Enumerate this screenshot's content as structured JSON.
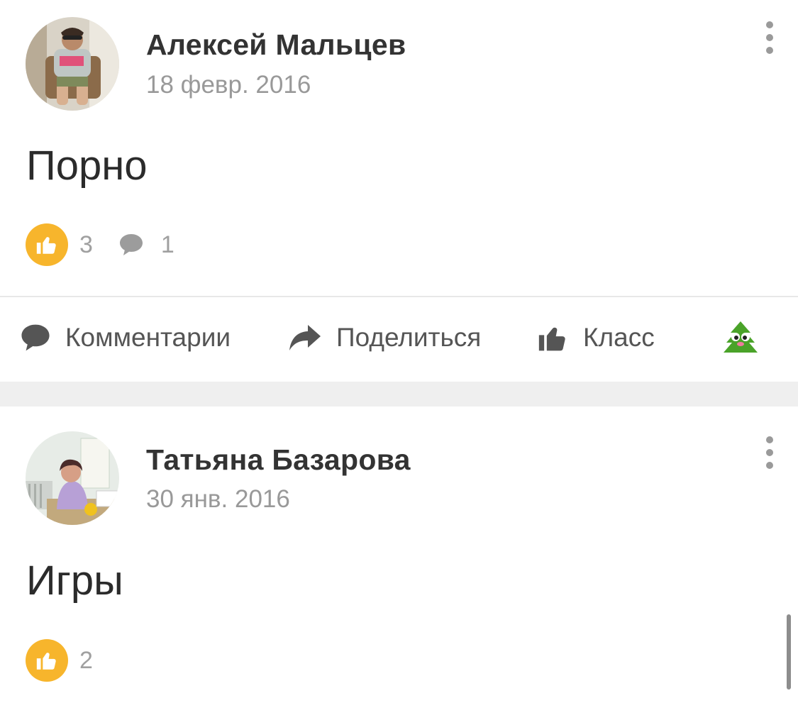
{
  "colors": {
    "like_badge": "#f7b52c",
    "section_gap": "#efefef",
    "present_icon": "#4aa329",
    "muted_text": "#999999"
  },
  "posts": [
    {
      "author": "Алексей Мальцев",
      "date": "18 февр. 2016",
      "text": "Порно",
      "likes": "3",
      "comments": "1",
      "icons": {
        "like": "thumbs-up-icon",
        "comment": "comment-bubble-icon",
        "menu": "more-vertical-icon"
      }
    },
    {
      "author": "Татьяна Базарова",
      "date": "30 янв. 2016",
      "text": "Игры",
      "likes": "2",
      "icons": {
        "like": "thumbs-up-icon",
        "menu": "more-vertical-icon"
      }
    }
  ],
  "actions": {
    "comments": "Комментарии",
    "share": "Поделиться",
    "class": "Класс",
    "icons": {
      "comments": "comment-bubble-icon",
      "share": "share-arrow-icon",
      "class": "thumbs-up-icon",
      "present": "tree-present-icon"
    }
  }
}
